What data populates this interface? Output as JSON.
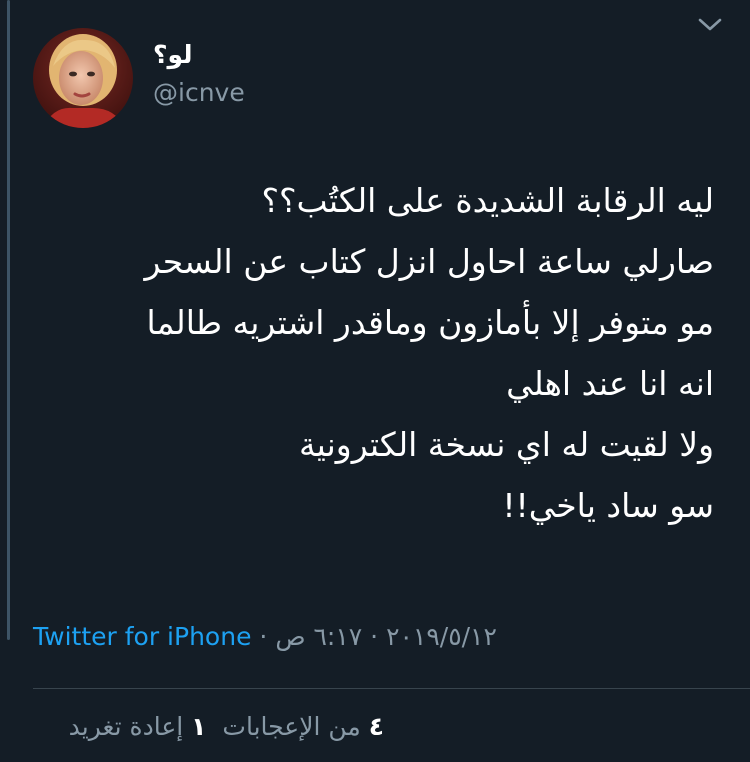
{
  "tweet": {
    "display_name": "لو؟",
    "handle": "@icnve",
    "text_lines": [
      "ليه الرقابة الشديدة على الكتُب؟؟",
      "صارلي ساعة احاول انزل كتاب عن السحر",
      "مو متوفر إلا بأمازون وماقدر اشتريه طالما",
      "انه انا عند اهلي",
      "ولا لقيت له اي نسخة الكترونية",
      "سو ساد ياخي!!"
    ],
    "time": "٦:١٧ ص",
    "date": "٢٠١٩/٥/١٢",
    "separator": "·",
    "source": "Twitter for iPhone"
  },
  "stats": {
    "retweets_count": "١",
    "retweets_label": "إعادة تغريد",
    "likes_count": "٤",
    "likes_label": "من الإعجابات"
  },
  "icons": {
    "menu": "chevron-down-icon",
    "avatar": "profile-photo"
  }
}
